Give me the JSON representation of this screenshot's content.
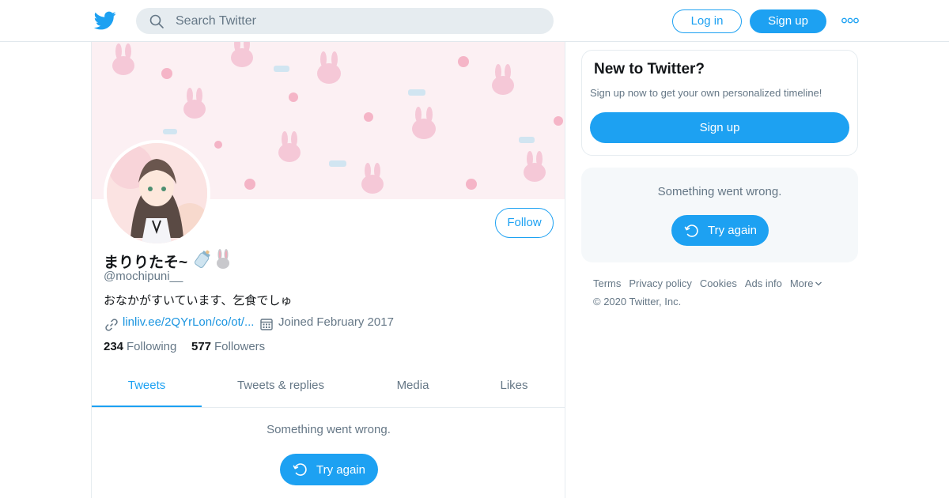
{
  "header": {
    "search_placeholder": "Search Twitter",
    "login_label": "Log in",
    "signup_label": "Sign up"
  },
  "profile": {
    "display_name": "まりりたそ~",
    "handle": "@mochipuni__",
    "bio": "おなかがすいています、乞食でしゅ",
    "link": "linliv.ee/2QYrLon/co/ot/...",
    "joined": "Joined February 2017",
    "following_count": "234",
    "following_label": "Following",
    "followers_count": "577",
    "followers_label": "Followers",
    "follow_label": "Follow"
  },
  "tabs": [
    {
      "label": "Tweets",
      "active": true
    },
    {
      "label": "Tweets & replies",
      "active": false
    },
    {
      "label": "Media",
      "active": false
    },
    {
      "label": "Likes",
      "active": false
    }
  ],
  "timeline": {
    "error_text": "Something went wrong.",
    "try_again_label": "Try again"
  },
  "sidebar": {
    "new_title": "New to Twitter?",
    "new_subtitle": "Sign up now to get your own personalized timeline!",
    "signup_label": "Sign up",
    "error_text": "Something went wrong.",
    "try_again_label": "Try again"
  },
  "footer": {
    "links": [
      "Terms",
      "Privacy policy",
      "Cookies",
      "Ads info",
      "More"
    ],
    "copyright": "© 2020 Twitter, Inc."
  },
  "colors": {
    "accent": "#1da1f2",
    "secondary_text": "#657786",
    "border": "#e6ecf0"
  }
}
